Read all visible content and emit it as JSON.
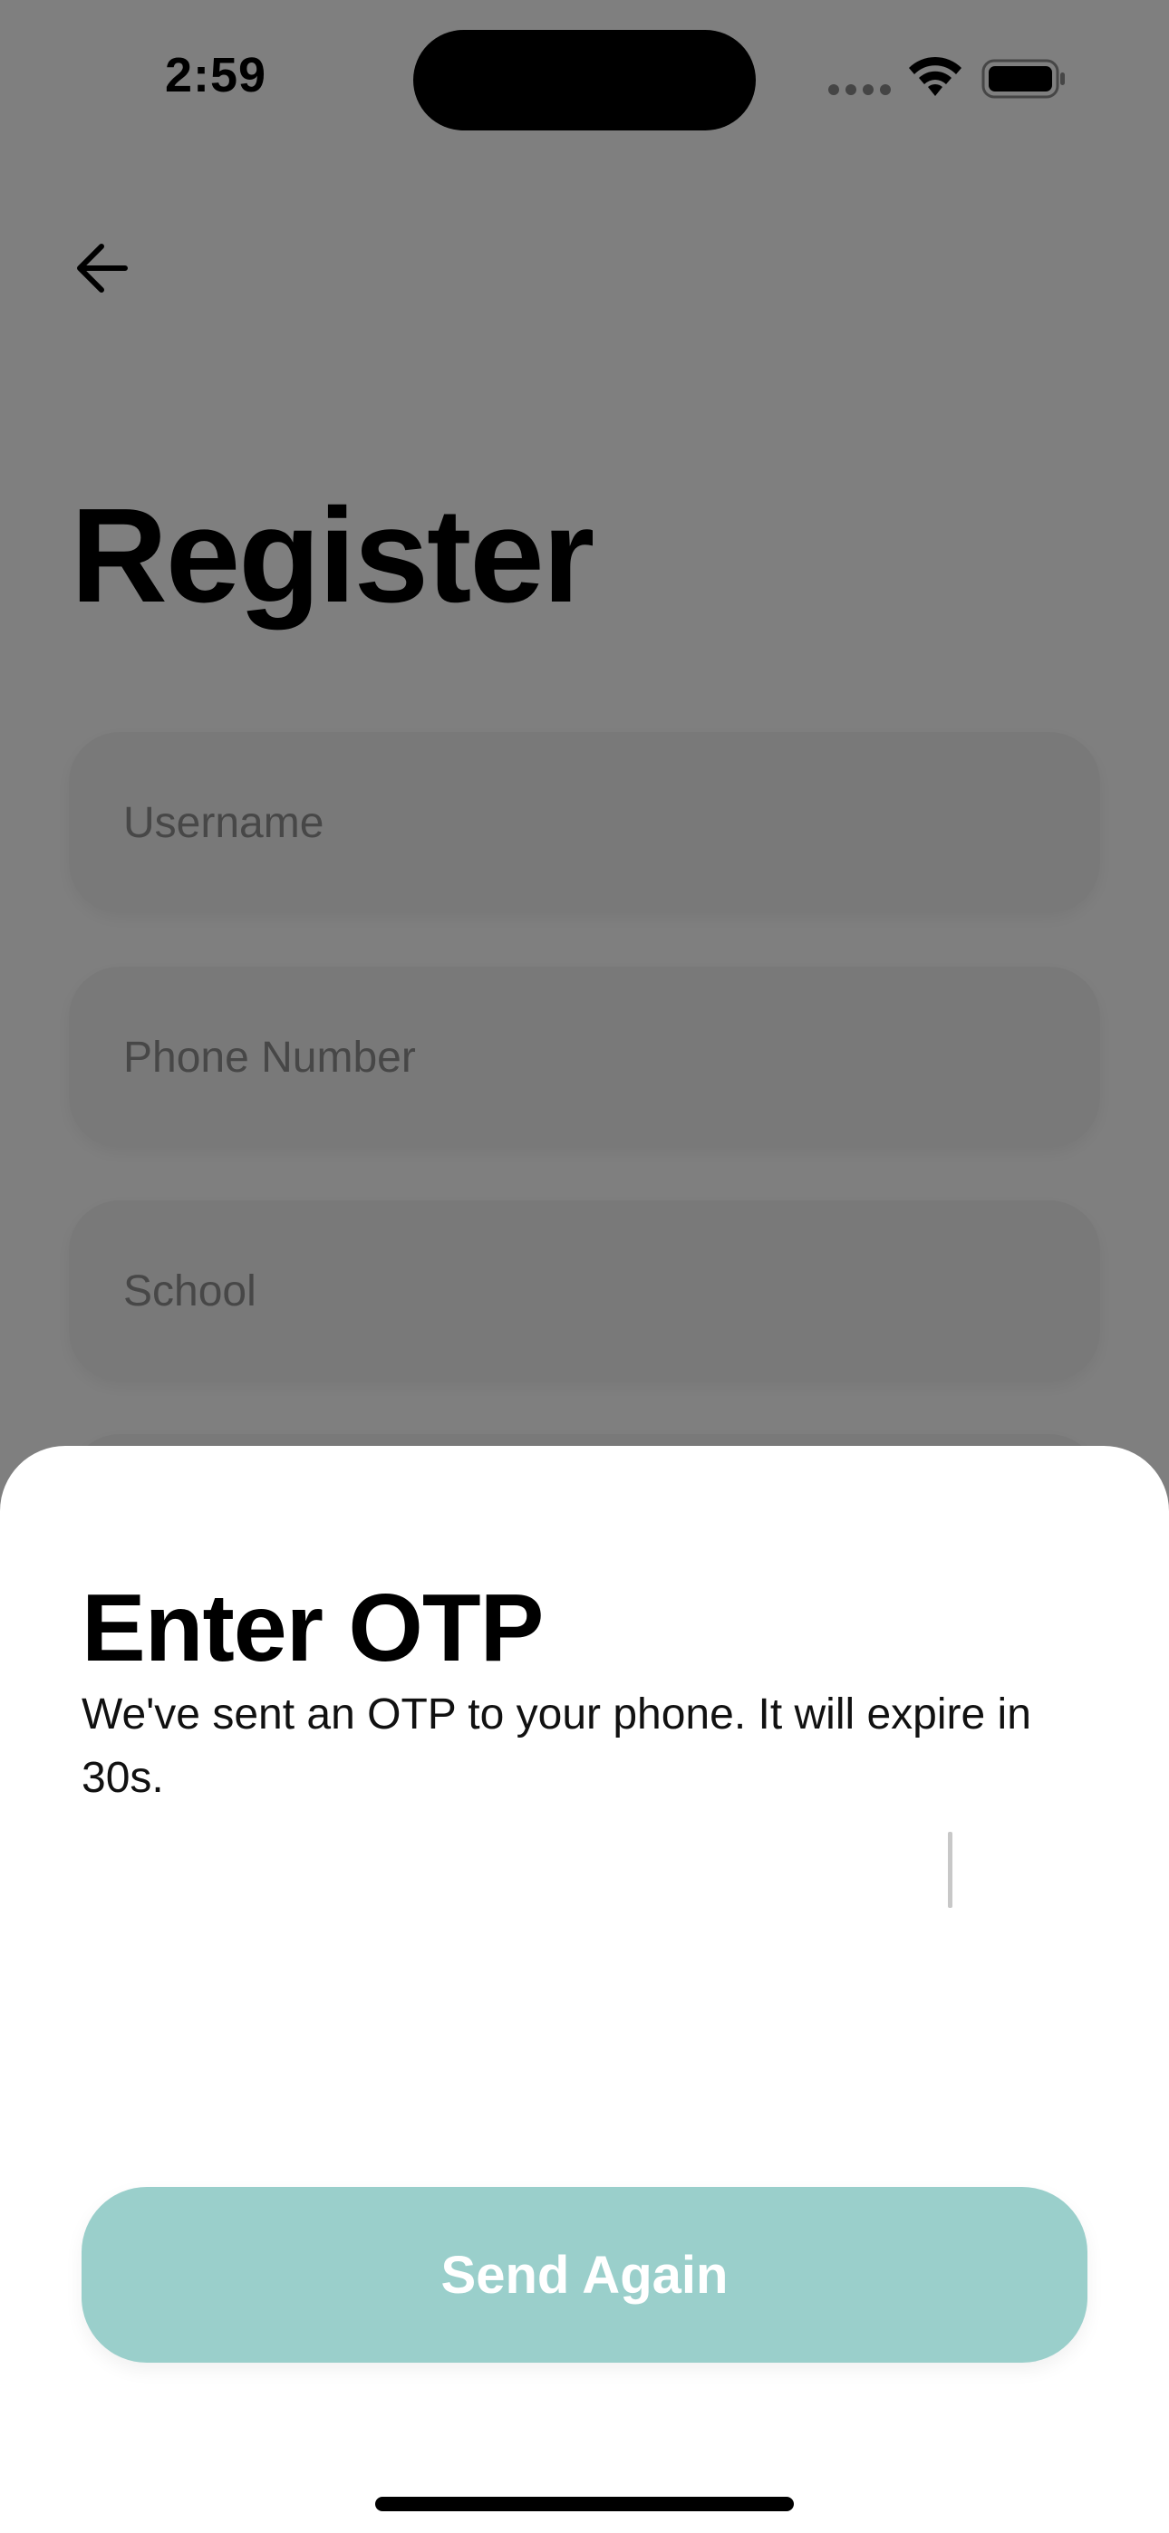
{
  "status_bar": {
    "time": "2:59"
  },
  "register": {
    "title": "Register",
    "fields": [
      {
        "placeholder": "Username"
      },
      {
        "placeholder": "Phone Number"
      },
      {
        "placeholder": "School"
      }
    ]
  },
  "otp_sheet": {
    "title": "Enter OTP",
    "message": "We've sent an OTP to your phone. It will expire in 30s.",
    "button_label": "Send Again"
  },
  "icons": {
    "back": "arrow-left",
    "signal": "cellular-signal",
    "wifi": "wifi",
    "battery": "battery-full"
  },
  "colors": {
    "button": "#9acfcb",
    "overlay": "rgba(0,0,0,0.5)"
  }
}
